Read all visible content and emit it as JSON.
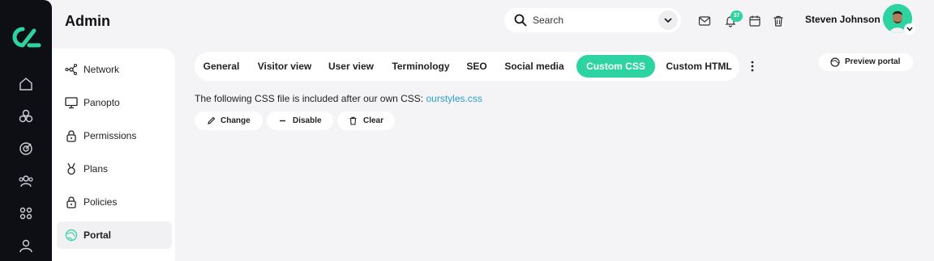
{
  "app": {
    "title": "Admin"
  },
  "header": {
    "search_placeholder": "Search",
    "notification_count": "37",
    "user_name": "Steven Johnson"
  },
  "rail": {
    "icons": [
      "logo-icon",
      "home-icon",
      "cubes-icon",
      "target-icon",
      "users-icon",
      "grid-icon",
      "profile-icon"
    ]
  },
  "sidebar": {
    "items": [
      {
        "label": "Network",
        "icon": "network-icon"
      },
      {
        "label": "Panopto",
        "icon": "monitor-icon"
      },
      {
        "label": "Permissions",
        "icon": "lock-icon"
      },
      {
        "label": "Plans",
        "icon": "medal-icon"
      },
      {
        "label": "Policies",
        "icon": "lock-icon"
      },
      {
        "label": "Portal",
        "icon": "globe-icon",
        "active": true
      }
    ]
  },
  "tabs": [
    {
      "label": "General"
    },
    {
      "label": "Visitor view"
    },
    {
      "label": "User view"
    },
    {
      "label": "Terminology"
    },
    {
      "label": "SEO"
    },
    {
      "label": "Social media"
    },
    {
      "label": "Custom CSS",
      "active": true
    },
    {
      "label": "Custom HTML"
    }
  ],
  "preview_label": "Preview portal",
  "content": {
    "info_text": "The following CSS file is included after our own CSS:",
    "file_link": "ourstyles.css",
    "actions": {
      "change": "Change",
      "disable": "Disable",
      "clear": "Clear"
    }
  },
  "colors": {
    "accent": "#2ed3a2",
    "rail": "#0d0f14",
    "link": "#2a9fc9"
  }
}
